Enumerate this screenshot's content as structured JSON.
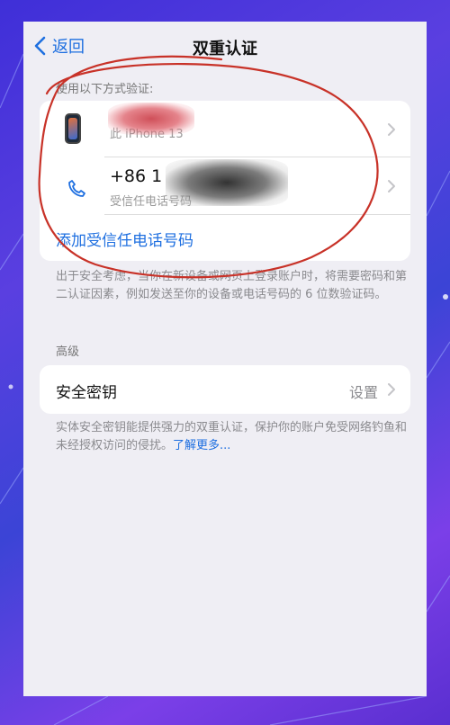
{
  "nav": {
    "back_label": "返回",
    "title": "双重认证"
  },
  "verify": {
    "header": "使用以下方式验证:",
    "device_name": "此 iPhone 13",
    "phone_number": "+86 1",
    "phone_sub": "受信任电话号码",
    "add_label": "添加受信任电话号码",
    "footnote": "出于安全考虑，当你在新设备或网页上登录账户时，将需要密码和第二认证因素，例如发送至你的设备或电话号码的 6 位数验证码。"
  },
  "advanced": {
    "header": "高级",
    "key_label": "安全密钥",
    "key_value": "设置",
    "footnote": "实体安全密钥能提供强力的双重认证，保护你的账户免受网络钓鱼和未经授权访问的侵扰。",
    "learn_more": "了解更多..."
  },
  "icons": {
    "back": "chevron-left-icon",
    "device": "iphone-icon",
    "phone": "phone-icon",
    "chevron": "chevron-right-icon"
  },
  "colors": {
    "accent": "#1e6fe0",
    "annotation": "#c83228"
  }
}
